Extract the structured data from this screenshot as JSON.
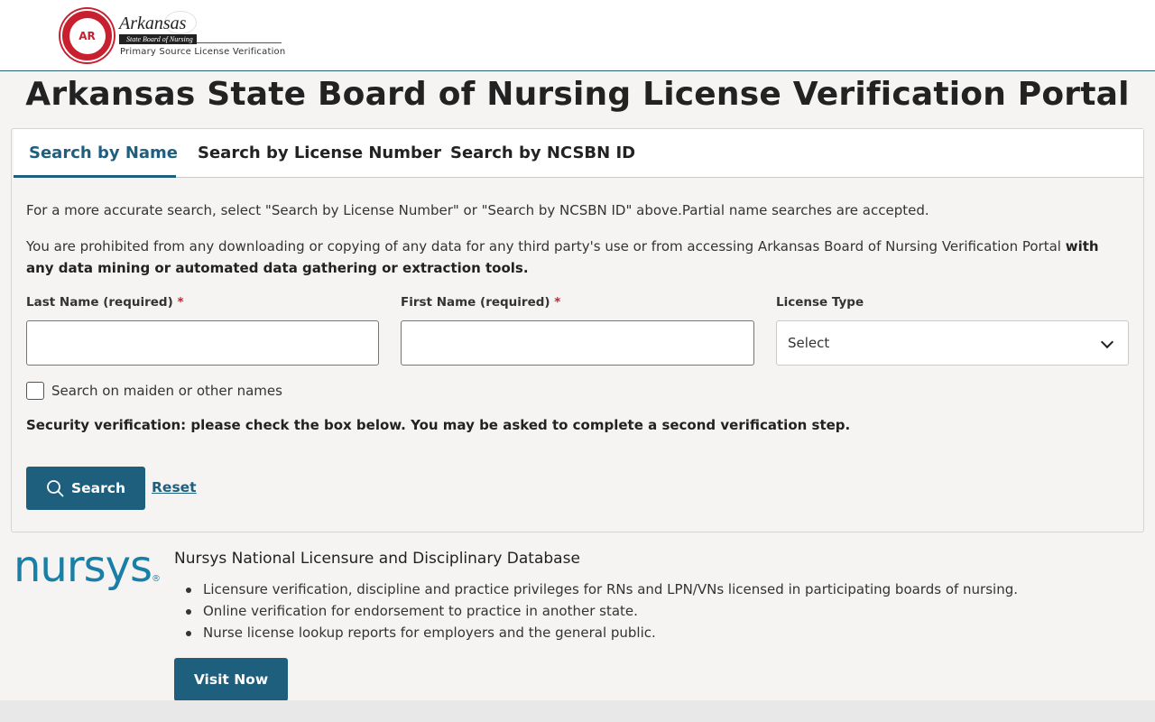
{
  "header": {
    "seal_text": "AR",
    "logo_word": "Arkansas",
    "logo_sub": "State Board of Nursing",
    "tagline": "Primary Source License Verification"
  },
  "page_title": "Arkansas State Board of Nursing License Verification Portal",
  "tabs": [
    {
      "label": "Search by Name",
      "active": true
    },
    {
      "label": "Search by License Number",
      "active": false
    },
    {
      "label": "Search by NCSBN ID",
      "active": false
    }
  ],
  "notes": {
    "accuracy": "For a more accurate search, select \"Search by License Number\" or \"Search by NCSBN ID\" above.Partial name searches are accepted.",
    "prohibited_prefix": "You are prohibited from any downloading or copying of any data for any third party's use or from accessing Arkansas Board of Nursing Verification Portal ",
    "prohibited_bold": "with any data mining or automated data gathering or extraction tools."
  },
  "form": {
    "last_name_label": "Last Name (required)",
    "first_name_label": "First Name (required)",
    "required_mark": "*",
    "license_type_label": "License Type",
    "license_type_value": "Select",
    "last_name_value": "",
    "first_name_value": "",
    "maiden_checkbox_label": "Search on maiden or other names",
    "security_text": "Security verification: please check the box below. You may be asked to complete a second verification step.",
    "search_label": "Search",
    "reset_label": "Reset"
  },
  "nursys": {
    "logo_text": "nursys",
    "logo_mark": "®",
    "title": "Nursys National Licensure and Disciplinary Database",
    "items": [
      "Licensure verification, discipline and practice privileges for RNs and LPN/VNs licensed in participating boards of nursing.",
      "Online verification for endorsement to practice in another state.",
      "Nurse license lookup reports for employers and the general public."
    ],
    "visit_label": "Visit Now"
  },
  "colors": {
    "accent": "#1e5f7e",
    "required": "#c8202f",
    "nursys_brand": "#1a7fa6"
  }
}
